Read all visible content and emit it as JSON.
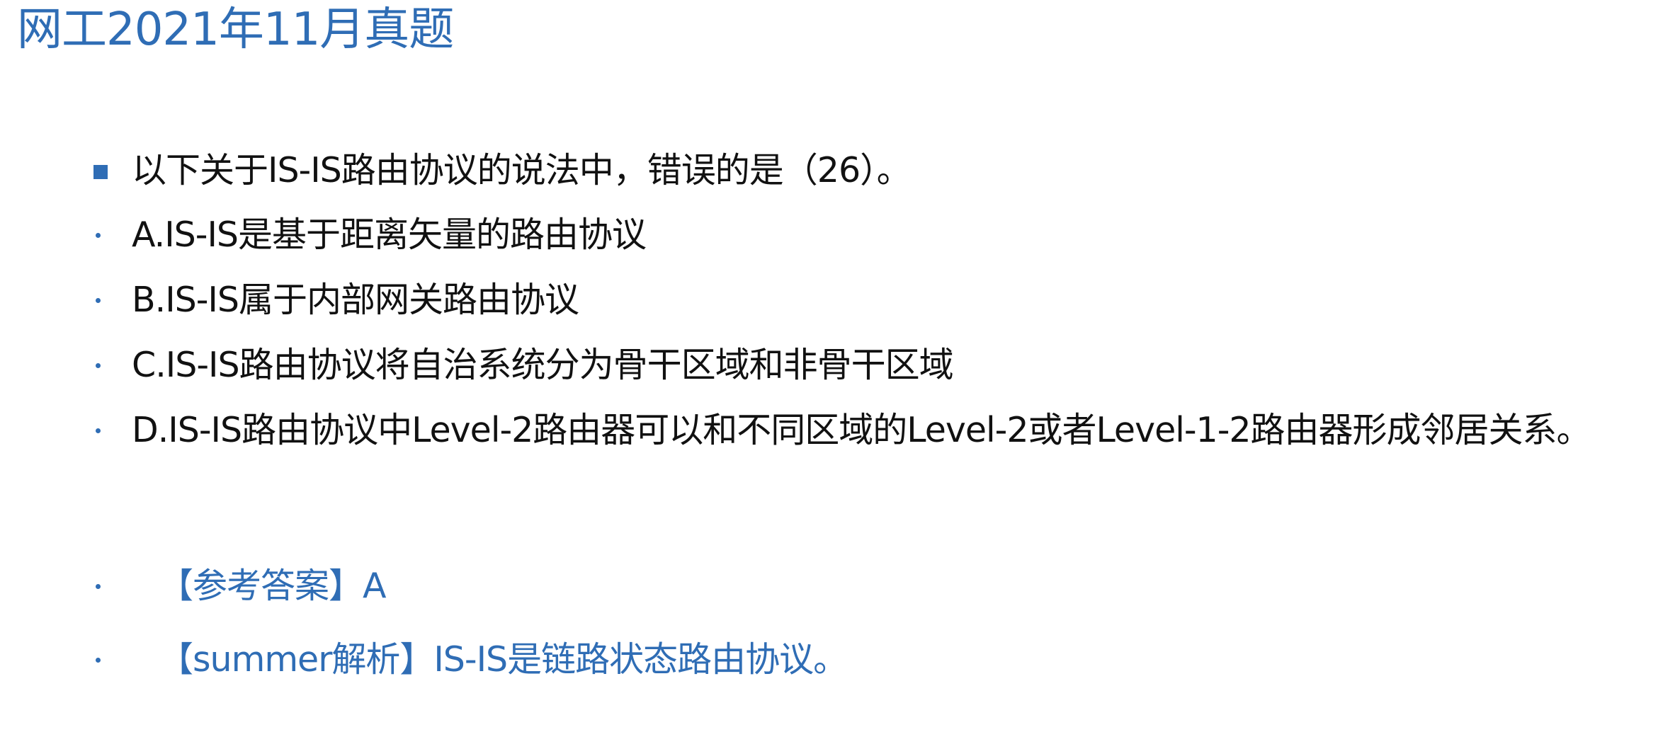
{
  "title": "网工2021年11月真题",
  "question": "以下关于IS-IS路由协议的说法中，错误的是（26）。",
  "options": [
    "A.IS-IS是基于距离矢量的路由协议",
    "B.IS-IS属于内部网关路由协议",
    "C.IS-IS路由协议将自治系统分为骨干区域和非骨干区域",
    "D.IS-IS路由协议中Level-2路由器可以和不同区域的Level-2或者Level-1-2路由器形成邻居关系。"
  ],
  "answer": "【参考答案】A",
  "analysis": "【summer解析】IS-IS是链路状态路由协议。",
  "colors": {
    "accent": "#2f6db5",
    "text": "#111111",
    "background": "#ffffff"
  }
}
